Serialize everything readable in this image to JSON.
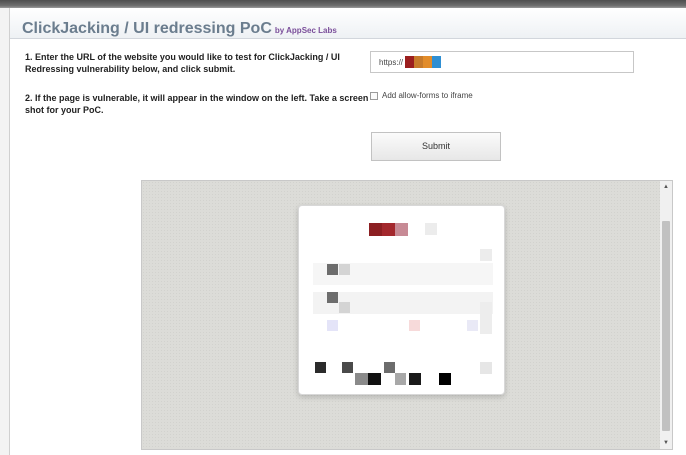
{
  "header": {
    "title": "ClickJacking / UI redressing PoC",
    "byline": "by AppSec Labs"
  },
  "instructions": {
    "step1": "1. Enter the URL of the website you would like to test for ClickJacking / UI Redressing vulnerability below, and click submit.",
    "step2": "2. If the page is vulnerable, it will appear in the window on the left. Take a screen shot for your PoC."
  },
  "form": {
    "url_value": "https://",
    "allow_forms_label": "Add allow-forms to iframe",
    "allow_forms_checked": false,
    "submit_label": "Submit"
  },
  "colors": {
    "title": "#6b7d8e",
    "byline": "#7a4e9a",
    "url_redaction": [
      "#9b1e1e",
      "#c77a2a",
      "#e28c2a",
      "#2f8fd3"
    ]
  },
  "icons": {
    "scroll_up": "triangle-up-icon",
    "scroll_down": "triangle-down-icon"
  }
}
